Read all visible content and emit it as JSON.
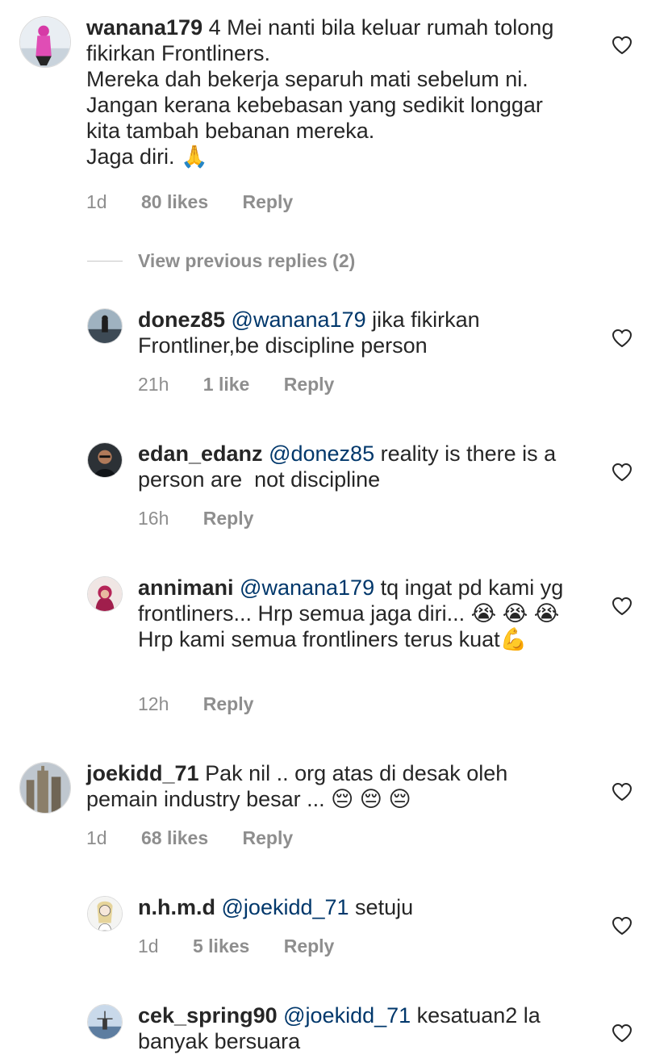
{
  "comments": [
    {
      "username": "wanana179",
      "text": " 4 Mei nanti bila keluar rumah tolong fikirkan Frontliners.\nMereka dah bekerja separuh mati sebelum ni. Jangan kerana kebebasan yang sedikit longgar kita tambah bebanan mereka.\nJaga diri. 🙏",
      "time": "1d",
      "likes": "80 likes",
      "reply_label": "Reply"
    },
    {
      "view_previous": "View previous replies (2)"
    },
    {
      "username": "donez85",
      "mention": "@wanana179",
      "text": " jika fikirkan Frontliner,be discipline person",
      "time": "21h",
      "likes": "1 like",
      "reply_label": "Reply"
    },
    {
      "username": "edan_edanz",
      "mention": "@donez85",
      "text": " reality is there is a person are  not discipline",
      "time": "16h",
      "reply_label": "Reply"
    },
    {
      "username": "annimani",
      "mention": "@wanana179",
      "text": " tq ingat pd kami yg frontliners... Hrp semua jaga diri... 😭 😭 😭  Hrp kami semua frontliners terus kuat💪",
      "time": "12h",
      "reply_label": "Reply"
    },
    {
      "username": "joekidd_71",
      "text": " Pak nil .. org atas di desak oleh pemain industry besar ... 😔 😔 😔",
      "time": "1d",
      "likes": "68 likes",
      "reply_label": "Reply"
    },
    {
      "username": "n.h.m.d",
      "mention": "@joekidd_71",
      "text": " setuju",
      "time": "1d",
      "likes": "5 likes",
      "reply_label": "Reply"
    },
    {
      "username": "cek_spring90",
      "mention": "@joekidd_71",
      "text": " kesatuan2 la banyak bersuara"
    }
  ],
  "icons": {
    "heart": "heart-outline-icon"
  },
  "colors": {
    "text": "#262626",
    "secondary": "#8e8e8e",
    "mention": "#00376b"
  }
}
